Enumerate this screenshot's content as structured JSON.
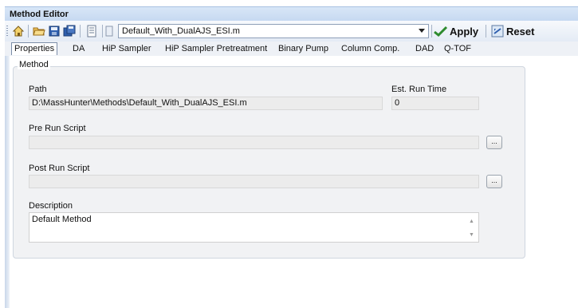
{
  "window": {
    "title": "Method Editor"
  },
  "toolbar": {
    "icons": [
      "home-icon",
      "open-icon",
      "save-icon",
      "save-as-icon",
      "sheet-icon"
    ],
    "method_selector": "Default_With_DualAJS_ESI.m",
    "apply_label": "Apply",
    "reset_label": "Reset"
  },
  "tabs": [
    "Properties",
    "DA",
    "HiP Sampler",
    "HiP Sampler Pretreatment",
    "Binary Pump",
    "Column Comp.",
    "DAD",
    "Q-TOF"
  ],
  "active_tab": "Properties",
  "method": {
    "group_label": "Method",
    "path_label": "Path",
    "path_value": "D:\\MassHunter\\Methods\\Default_With_DualAJS_ESI.m",
    "runtime_label": "Est. Run Time",
    "runtime_value": "0",
    "pre_label": "Pre Run Script",
    "pre_value": "",
    "post_label": "Post Run Script",
    "post_value": "",
    "browse_label": "...",
    "description_label": "Description",
    "description_value": "Default Method"
  },
  "colors": {
    "titlebar": "#c6d9f1",
    "panel": "#f1f2f4",
    "apply_check": "#2e8b2e"
  }
}
